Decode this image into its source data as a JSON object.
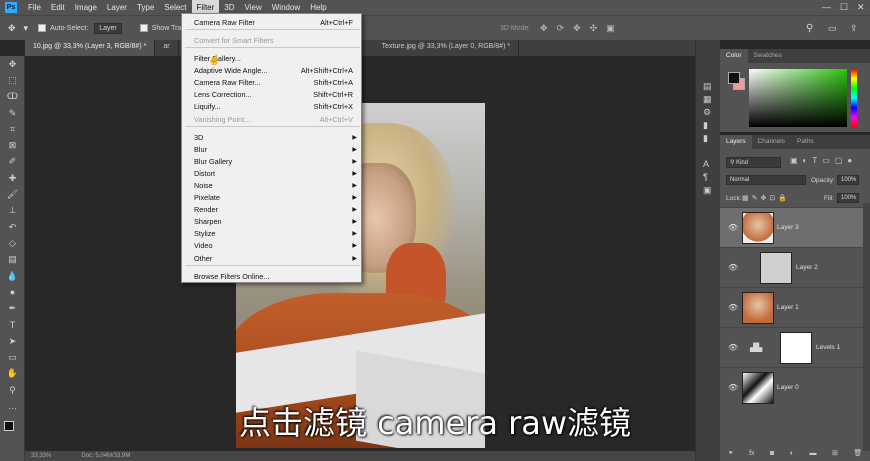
{
  "menubar": {
    "logo": "Ps",
    "items": [
      "File",
      "Edit",
      "Image",
      "Layer",
      "Type",
      "Select",
      "Filter",
      "3D",
      "View",
      "Window",
      "Help"
    ],
    "active": "Filter"
  },
  "options": {
    "auto_select_label": "Auto-Select:",
    "auto_select_value": "Layer",
    "show_transform": "Show Tra",
    "mode_3d": "3D Mode:"
  },
  "tabs": [
    {
      "label": "10.jpg @ 33,3% (Layer 3, RGB/8#) *"
    },
    {
      "label": "ar"
    },
    {
      "label": "Texture.jpg @ 33,3% (Layer 0, RGB/8#) *"
    }
  ],
  "filter_menu": {
    "items": [
      {
        "label": "Camera Raw Filter",
        "shortcut": "Alt+Ctrl+F",
        "disabled": false,
        "submenu": false
      },
      {
        "label": "Convert for Smart Filters",
        "shortcut": "",
        "disabled": true,
        "submenu": false
      },
      {
        "label": "Filter Gallery...",
        "shortcut": "",
        "disabled": false,
        "submenu": false
      },
      {
        "label": "Adaptive Wide Angle...",
        "shortcut": "Alt+Shift+Ctrl+A",
        "disabled": false,
        "submenu": false
      },
      {
        "label": "Camera Raw Filter...",
        "shortcut": "Shift+Ctrl+A",
        "disabled": false,
        "submenu": false
      },
      {
        "label": "Lens Correction...",
        "shortcut": "Shift+Ctrl+R",
        "disabled": false,
        "submenu": false
      },
      {
        "label": "Liquify...",
        "shortcut": "Shift+Ctrl+X",
        "disabled": false,
        "submenu": false
      },
      {
        "label": "Vanishing Point...",
        "shortcut": "Alt+Ctrl+V",
        "disabled": true,
        "submenu": false
      },
      {
        "label": "3D",
        "shortcut": "",
        "disabled": false,
        "submenu": true
      },
      {
        "label": "Blur",
        "shortcut": "",
        "disabled": false,
        "submenu": true
      },
      {
        "label": "Blur Gallery",
        "shortcut": "",
        "disabled": false,
        "submenu": true
      },
      {
        "label": "Distort",
        "shortcut": "",
        "disabled": false,
        "submenu": true
      },
      {
        "label": "Noise",
        "shortcut": "",
        "disabled": false,
        "submenu": true
      },
      {
        "label": "Pixelate",
        "shortcut": "",
        "disabled": false,
        "submenu": true
      },
      {
        "label": "Render",
        "shortcut": "",
        "disabled": false,
        "submenu": true
      },
      {
        "label": "Sharpen",
        "shortcut": "",
        "disabled": false,
        "submenu": true
      },
      {
        "label": "Stylize",
        "shortcut": "",
        "disabled": false,
        "submenu": true
      },
      {
        "label": "Video",
        "shortcut": "",
        "disabled": false,
        "submenu": true
      },
      {
        "label": "Other",
        "shortcut": "",
        "disabled": false,
        "submenu": true
      },
      {
        "label": "Browse Filters Online...",
        "shortcut": "",
        "disabled": false,
        "submenu": false
      }
    ]
  },
  "color_panel": {
    "tab_color": "Color",
    "tab_swatches": "Swatches",
    "fg": "#111111",
    "bg": "#f19a9a"
  },
  "layers_panel": {
    "tabs": [
      "Layers",
      "Channels",
      "Paths"
    ],
    "kind_label": "Kind",
    "blend_mode": "Normal",
    "opacity_label": "Opacity:",
    "opacity_value": "100%",
    "lock_label": "Lock:",
    "fill_label": "Fill:",
    "fill_value": "100%",
    "layers": [
      {
        "name": "Layer 3",
        "active": true
      },
      {
        "name": "Layer 2",
        "active": false
      },
      {
        "name": "Layer 1",
        "active": false
      },
      {
        "name": "Levels 1",
        "active": false
      },
      {
        "name": "Layer 0",
        "active": false
      }
    ]
  },
  "status": {
    "zoom": "33,33%",
    "doc": "Doc: 5,04M/33,9M"
  },
  "subtitle": "点击滤镜 camera raw滤镜"
}
